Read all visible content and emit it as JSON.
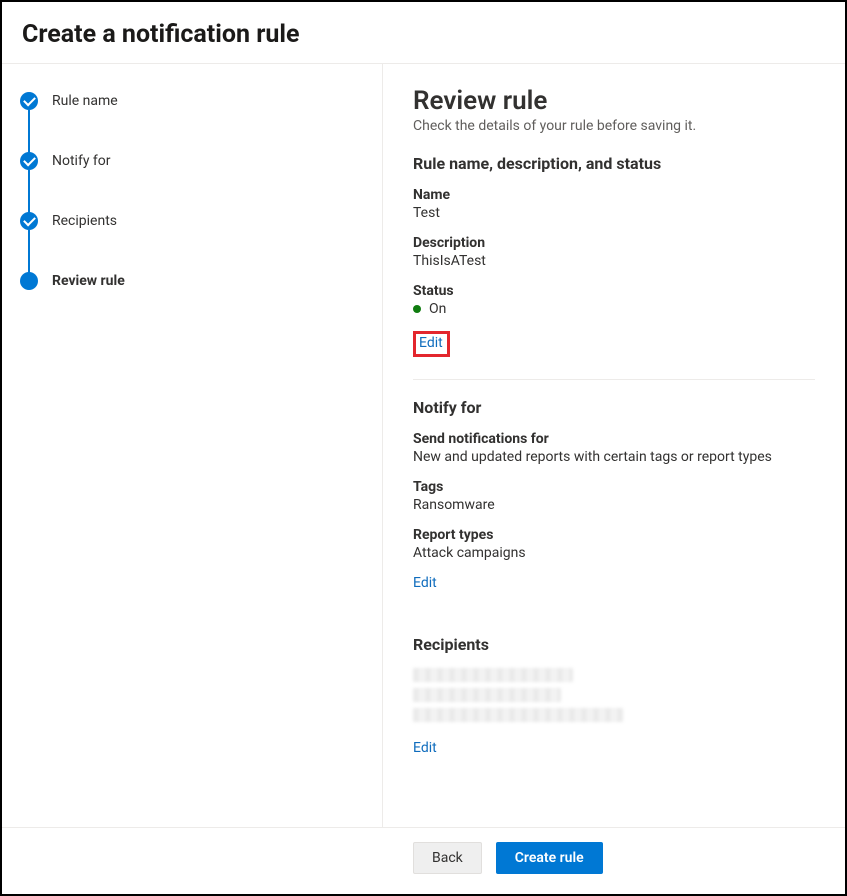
{
  "header": {
    "title": "Create a notification rule"
  },
  "steps": [
    {
      "label": "Rule name",
      "state": "done"
    },
    {
      "label": "Notify for",
      "state": "done"
    },
    {
      "label": "Recipients",
      "state": "done"
    },
    {
      "label": "Review rule",
      "state": "current"
    }
  ],
  "review": {
    "heading": "Review rule",
    "subtitle": "Check the details of your rule before saving it.",
    "sections": {
      "basics": {
        "title": "Rule name, description, and status",
        "name_label": "Name",
        "name_value": "Test",
        "description_label": "Description",
        "description_value": "ThisIsATest",
        "status_label": "Status",
        "status_value": "On",
        "status_color": "#107c10",
        "edit_label": "Edit"
      },
      "notify": {
        "title": "Notify for",
        "send_label": "Send notifications for",
        "send_value": "New and updated reports with certain tags or report types",
        "tags_label": "Tags",
        "tags_value": "Ransomware",
        "report_types_label": "Report types",
        "report_types_value": "Attack campaigns",
        "edit_label": "Edit"
      },
      "recipients": {
        "title": "Recipients",
        "edit_label": "Edit"
      }
    }
  },
  "footer": {
    "back_label": "Back",
    "create_label": "Create rule"
  }
}
